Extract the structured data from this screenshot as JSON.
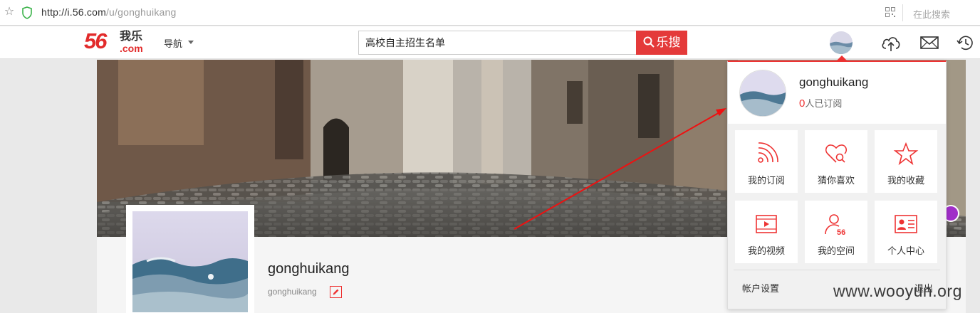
{
  "browser": {
    "url_host": "http://i.56.com",
    "url_path": "/u/gonghuikang",
    "search_placeholder": "在此搜索"
  },
  "header": {
    "logo_number": "56",
    "logo_cn": "我乐",
    "logo_domain": ".com",
    "nav_label": "导航",
    "search_value": "高校自主招生名单",
    "search_button": "乐搜"
  },
  "profile": {
    "username": "gonghuikang",
    "sub_username": "gonghuikang"
  },
  "dropdown": {
    "username": "gonghuikang",
    "subscriber_count": "0",
    "subscriber_suffix": "人已订阅",
    "tiles": [
      {
        "label": "我的订阅",
        "icon": "rss-icon"
      },
      {
        "label": "猜你喜欢",
        "icon": "heart-search-icon"
      },
      {
        "label": "我的收藏",
        "icon": "star-icon"
      },
      {
        "label": "我的视频",
        "icon": "video-icon"
      },
      {
        "label": "我的空间",
        "icon": "user-56-icon"
      },
      {
        "label": "个人中心",
        "icon": "id-card-icon"
      }
    ],
    "account_settings": "帐户设置",
    "logout": "退出"
  },
  "watermark": "www.wooyun.org",
  "colors": {
    "brand_red": "#e43a3a",
    "purple": "#a02ec8"
  }
}
